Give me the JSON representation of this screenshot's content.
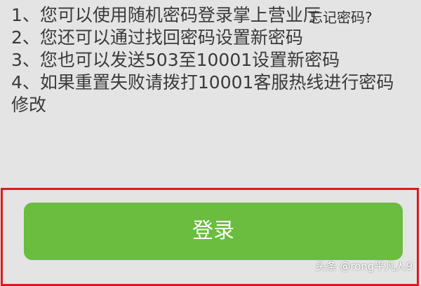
{
  "tips": [
    "1、您可以使用随机密码登录掌上营业厅",
    "2、您还可以通过找回密码设置新密码",
    "3、您也可以发送503至10001设置新密码",
    "4、如果重置失败请拨打10001客服热线进行密码修改"
  ],
  "forgot_password_label": "忘记密码?",
  "login_button_label": "登录",
  "watermark": "头条 @rong平凡人9",
  "colors": {
    "background": "#e4e4e4",
    "button": "#6abd3e",
    "highlight_border": "#e0191f"
  }
}
